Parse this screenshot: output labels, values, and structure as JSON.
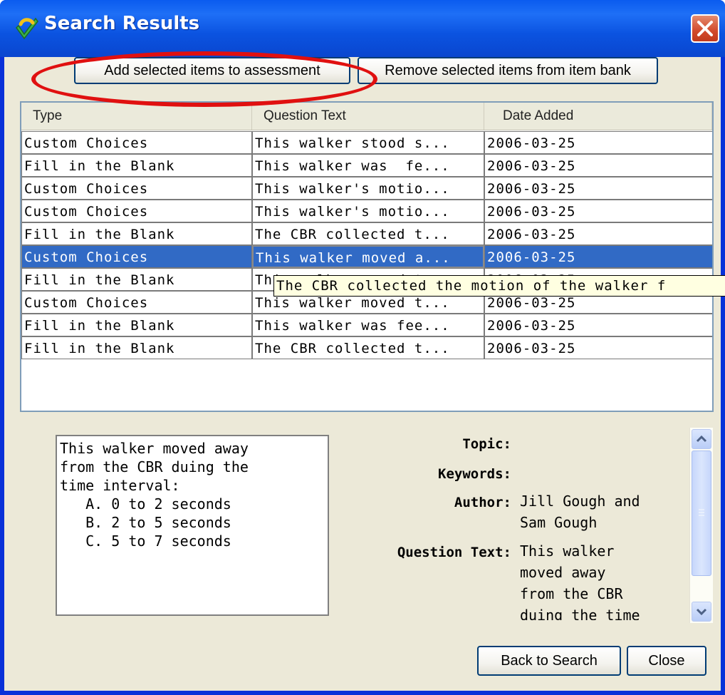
{
  "window": {
    "title": "Search Results"
  },
  "toolbar": {
    "add_label": "Add selected items to assessment",
    "remove_label": "Remove selected items from item bank"
  },
  "table": {
    "columns": [
      "Type",
      "Question Text",
      "Date Added"
    ],
    "rows": [
      {
        "type": "Custom Choices",
        "question": "This walker stood s...",
        "date": "2006-03-25"
      },
      {
        "type": "Fill in the Blank",
        "question": "This walker was  fe...",
        "date": "2006-03-25"
      },
      {
        "type": "Custom Choices",
        "question": "This walker's motio...",
        "date": "2006-03-25"
      },
      {
        "type": "Custom Choices",
        "question": "This walker's motio...",
        "date": "2006-03-25"
      },
      {
        "type": "Fill in the Blank",
        "question": "The CBR collected t...",
        "date": "2006-03-25"
      },
      {
        "type": "Custom Choices",
        "question": "This walker moved a...",
        "date": "2006-03-25",
        "selected": true
      },
      {
        "type": "Fill in the Blank",
        "question": "This walker moved t...",
        "date": "2006-03-25"
      },
      {
        "type": "Custom Choices",
        "question": "This walker moved t...",
        "date": "2006-03-25"
      },
      {
        "type": "Fill in the Blank",
        "question": "This walker was fee...",
        "date": "2006-03-25"
      },
      {
        "type": "Fill in the Blank",
        "question": "The CBR collected t...",
        "date": "2006-03-25"
      }
    ],
    "tooltip": "The CBR collected the motion of the walker f"
  },
  "preview": {
    "text": "This walker moved away\nfrom the CBR duing the\ntime interval:\n   A. 0 to 2 seconds\n   B. 2 to 5 seconds\n   C. 5 to 7 seconds"
  },
  "details": {
    "topic_label": "Topic:",
    "topic_value": "",
    "keywords_label": "Keywords:",
    "keywords_value": "",
    "author_label": "Author:",
    "author_value": "Jill Gough and\nSam Gough",
    "question_label": "Question Text:",
    "question_value": "This walker\nmoved away\nfrom the CBR\nduing the time"
  },
  "footer": {
    "back_label": "Back to Search",
    "close_label": "Close"
  },
  "colors": {
    "titlebar": "#0a5bef",
    "selection": "#316ac5",
    "annotation": "#e01010",
    "tooltip_bg": "#ffffe1"
  }
}
